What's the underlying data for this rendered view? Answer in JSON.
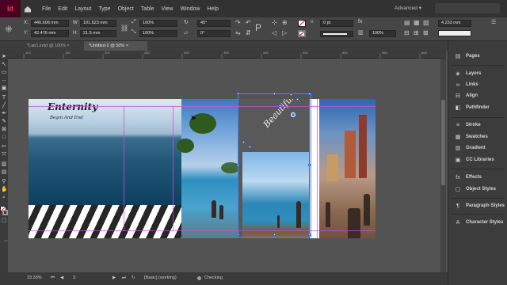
{
  "menubar": {
    "app_icon": "Id",
    "items": [
      "File",
      "Edit",
      "Layout",
      "Type",
      "Object",
      "Table",
      "View",
      "Window",
      "Help"
    ],
    "workspace": "Advanced ▾"
  },
  "control": {
    "x_label": "X:",
    "x_value": "440.606 mm",
    "y_label": "Y:",
    "y_value": "42.476 mm",
    "w_label": "W:",
    "w_value": "101.823 mm",
    "h_label": "H:",
    "h_value": "21.5 mm",
    "scale_x": "100%",
    "scale_y": "100%",
    "rotate": "45°",
    "shear": "0°",
    "stroke_weight": "0 pt",
    "opacity": "100%",
    "offset": "4.233 mm"
  },
  "tabs": [
    {
      "label": "*Lab1.indd @ 100%",
      "active": false
    },
    {
      "label": "*Untitled-2 @ 50%",
      "active": true
    }
  ],
  "ruler_ticks": [
    "100",
    "150",
    "200",
    "250",
    "300",
    "350",
    "400",
    "450",
    "500",
    "550",
    "600"
  ],
  "artwork": {
    "logo_title": "Enternity",
    "logo_subtitle": "Begin And End",
    "rotated_text": "Beautiful"
  },
  "status": {
    "zoom": "33.33%",
    "page": "3",
    "preflight_profile": "[Basic] (working)",
    "preflight_status": "Checking"
  },
  "panels": [
    {
      "label": "Pages",
      "icon": "pages-icon",
      "glyph": "▤"
    },
    {
      "label": "Layers",
      "icon": "layers-icon",
      "glyph": "◈"
    },
    {
      "label": "Links",
      "icon": "links-icon",
      "glyph": "∞"
    },
    {
      "label": "Align",
      "icon": "align-icon",
      "glyph": "⊟"
    },
    {
      "label": "Pathfinder",
      "icon": "pathfinder-icon",
      "glyph": "◧"
    },
    {
      "label": "Stroke",
      "icon": "stroke-icon",
      "glyph": "≡"
    },
    {
      "label": "Swatches",
      "icon": "swatches-icon",
      "glyph": "▦"
    },
    {
      "label": "Gradient",
      "icon": "gradient-icon",
      "glyph": "▥"
    },
    {
      "label": "CC Libraries",
      "icon": "cc-libraries-icon",
      "glyph": "▣"
    },
    {
      "label": "Effects",
      "icon": "effects-icon",
      "glyph": "fx"
    },
    {
      "label": "Object Styles",
      "icon": "object-styles-icon",
      "glyph": "▢"
    },
    {
      "label": "Paragraph Styles",
      "icon": "paragraph-styles-icon",
      "glyph": "¶"
    },
    {
      "label": "Character Styles",
      "icon": "character-styles-icon",
      "glyph": "A"
    }
  ],
  "colors": {
    "app_accent": "#ff3366",
    "guide": "#c850dc",
    "selection": "#3f86ff"
  }
}
